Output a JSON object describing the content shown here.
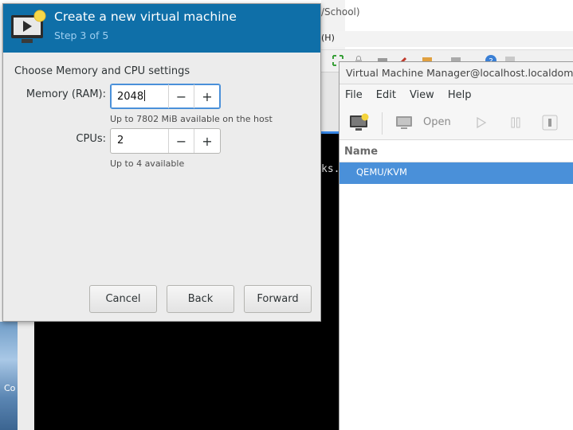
{
  "background": {
    "window_title_fragment": "/School)",
    "menu_fragment": "(H)",
    "terminal_fragment": "ks.",
    "left_strip_fragment": "Co"
  },
  "vmm": {
    "title": "Virtual Machine Manager@localhost.localdomain",
    "menu": [
      "File",
      "Edit",
      "View",
      "Help"
    ],
    "toolbar": {
      "new_icon": "new-vm-icon",
      "open_icon": "monitor-icon",
      "open_label": "Open",
      "run_icon": "play-icon",
      "pause_icon": "pause-icon",
      "shutdown_icon": "power-icon"
    },
    "column_header": "Name",
    "rows": [
      "QEMU/KVM"
    ]
  },
  "wizard": {
    "icon": "new-vm-icon",
    "title": "Create a new virtual machine",
    "step": "Step 3 of 5",
    "section_label": "Choose Memory and CPU settings",
    "memory": {
      "label": "Memory (RAM):",
      "value": "2048",
      "hint": "Up to 7802 MiB available on the host"
    },
    "cpus": {
      "label": "CPUs:",
      "value": "2",
      "hint": "Up to 4 available"
    },
    "stepper": {
      "minus": "−",
      "plus": "+"
    },
    "buttons": {
      "cancel": "Cancel",
      "back": "Back",
      "forward": "Forward"
    }
  },
  "colors": {
    "header": "#0f6fa8",
    "selection": "#4a90d9",
    "dialog_bg": "#ececec"
  }
}
